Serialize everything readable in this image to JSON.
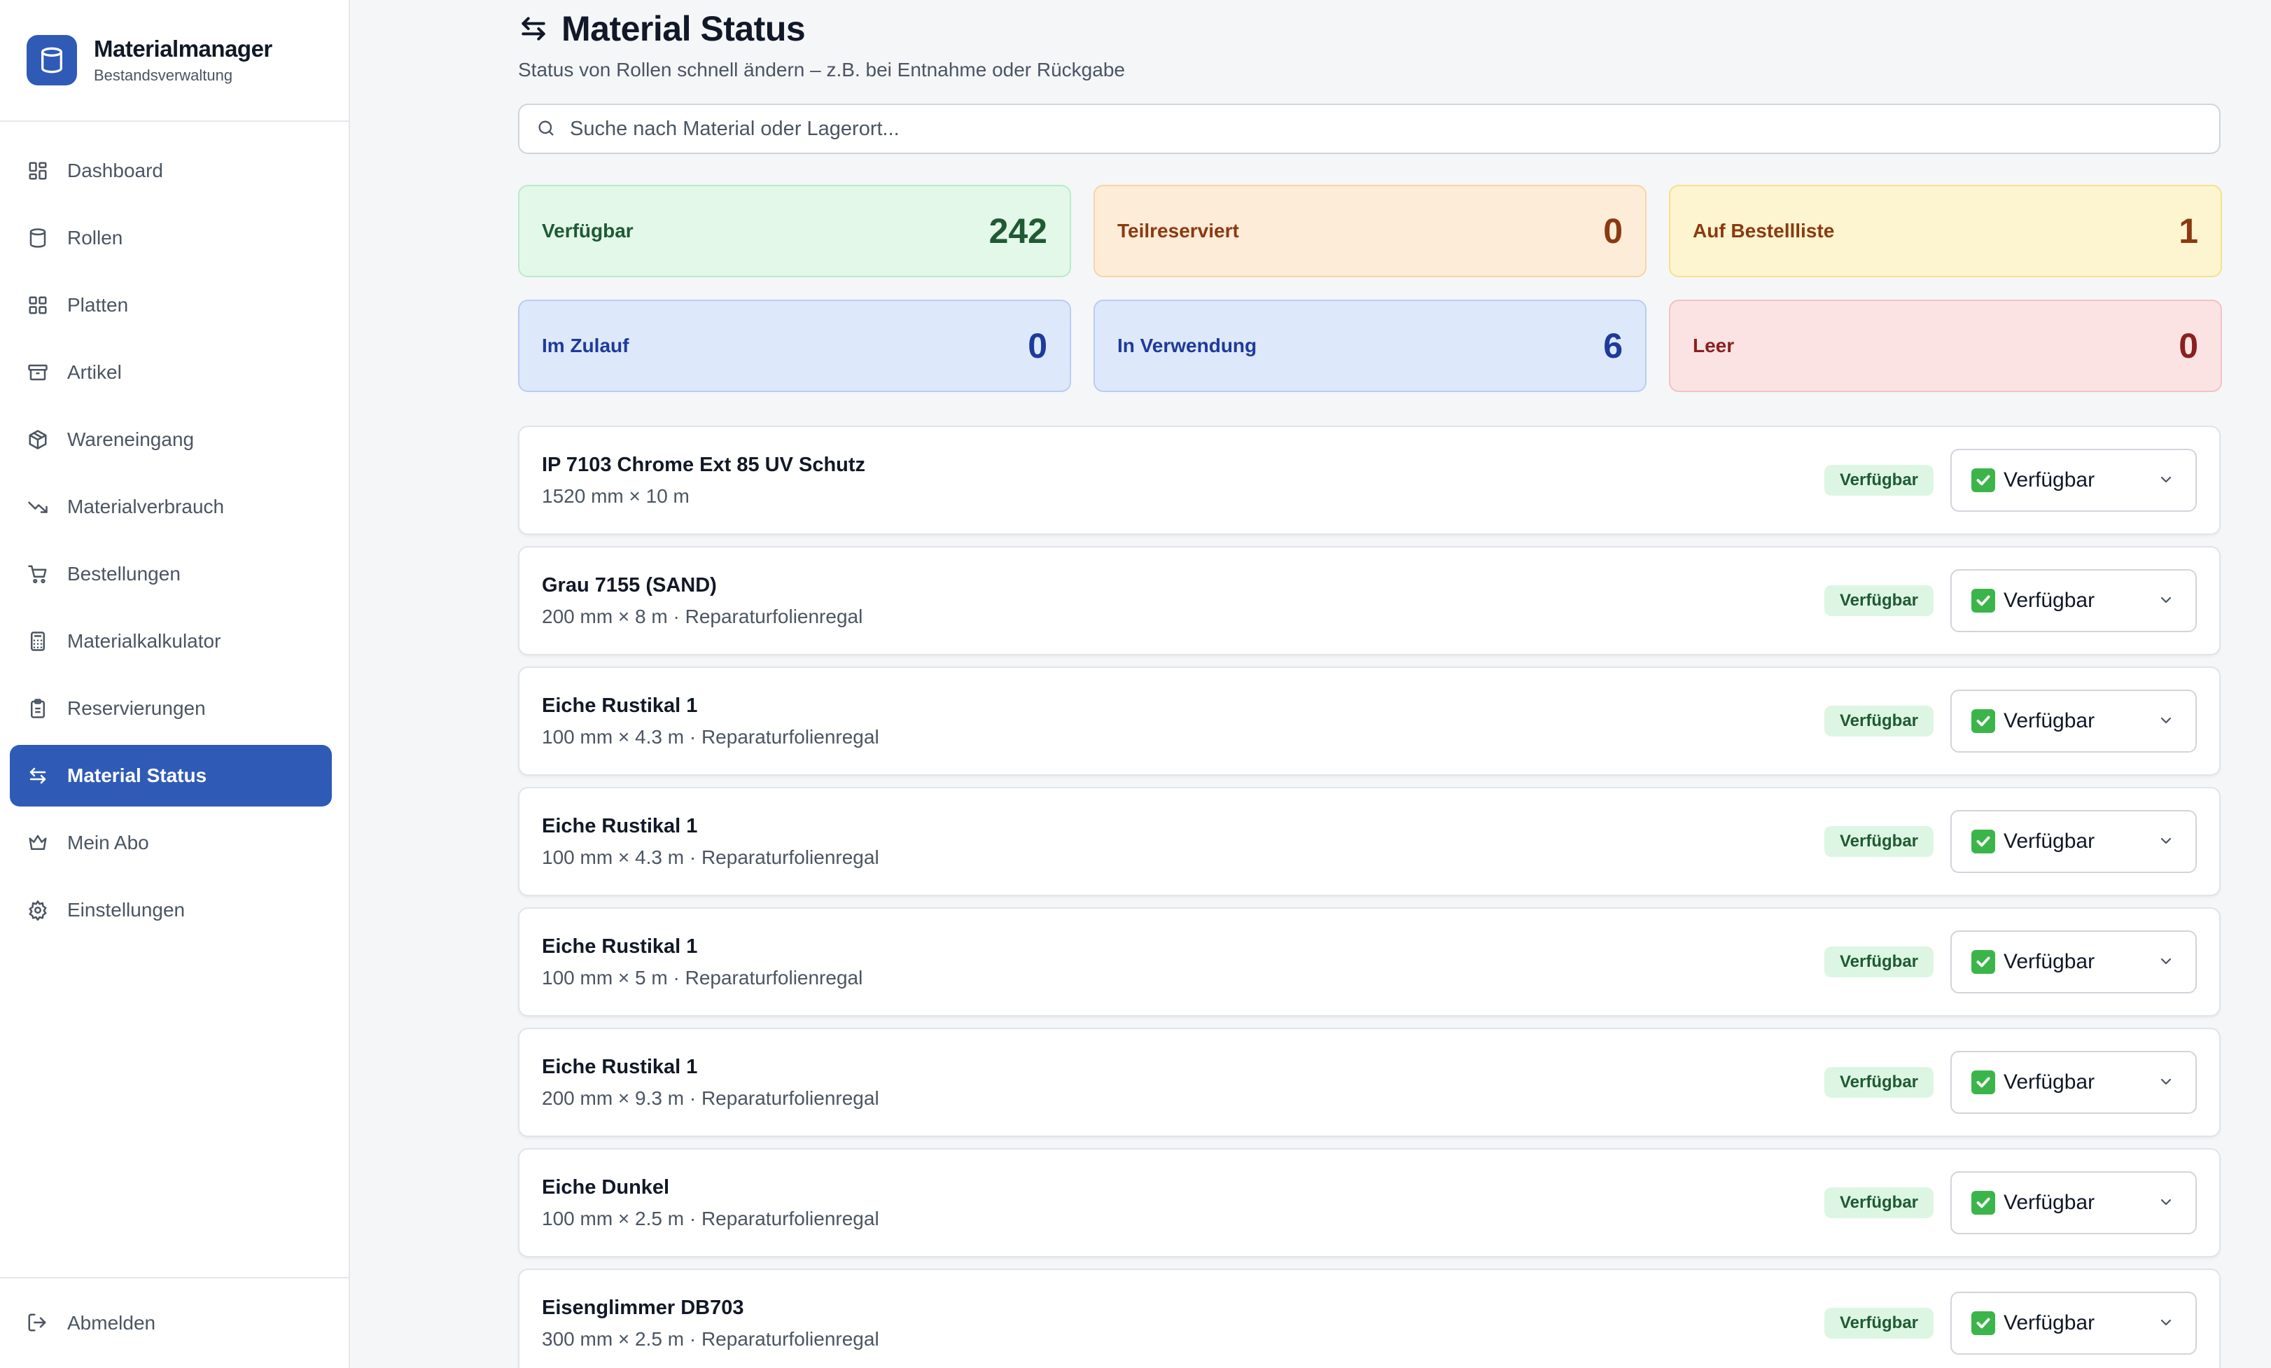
{
  "brand": {
    "name": "Materialmanager",
    "subtitle": "Bestandsverwaltung",
    "icon": "database-icon"
  },
  "sidebar": {
    "items": [
      {
        "label": "Dashboard",
        "icon": "dashboard-icon",
        "active": false
      },
      {
        "label": "Rollen",
        "icon": "roll-icon",
        "active": false
      },
      {
        "label": "Platten",
        "icon": "grid-icon",
        "active": false
      },
      {
        "label": "Artikel",
        "icon": "archive-icon",
        "active": false
      },
      {
        "label": "Wareneingang",
        "icon": "package-icon",
        "active": false
      },
      {
        "label": "Materialverbrauch",
        "icon": "trending-down-icon",
        "active": false
      },
      {
        "label": "Bestellungen",
        "icon": "cart-icon",
        "active": false
      },
      {
        "label": "Materialkalkulator",
        "icon": "calculator-icon",
        "active": false
      },
      {
        "label": "Reservierungen",
        "icon": "clipboard-icon",
        "active": false
      },
      {
        "label": "Material Status",
        "icon": "arrows-swap-icon",
        "active": true
      },
      {
        "label": "Mein Abo",
        "icon": "crown-icon",
        "active": false
      },
      {
        "label": "Einstellungen",
        "icon": "gear-icon",
        "active": false
      }
    ],
    "logout_label": "Abmelden"
  },
  "page": {
    "title": "Material Status",
    "subtitle": "Status von Rollen schnell ändern – z.B. bei Entnahme oder Rückgabe"
  },
  "search": {
    "placeholder": "Suche nach Material oder Lagerort...",
    "value": ""
  },
  "stats": [
    {
      "label": "Verfügbar",
      "count": "242",
      "color": "#e3f8e9"
    },
    {
      "label": "Teilreserviert",
      "count": "0",
      "color": "#fdecd8"
    },
    {
      "label": "Auf Bestellliste",
      "count": "1",
      "color": "#fdf5cf"
    },
    {
      "label": "Im Zulauf",
      "count": "0",
      "color": "#dde8fb"
    },
    {
      "label": "In Verwendung",
      "count": "6",
      "color": "#dde8fb"
    },
    {
      "label": "Leer",
      "count": "0",
      "color": "#fbe3e3"
    }
  ],
  "rolls": [
    {
      "title": "IP 7103 Chrome Ext 85 UV Schutz",
      "meta": "1520 mm × 10 m",
      "badge": "Verfügbar",
      "status": "Verfügbar"
    },
    {
      "title": "Grau 7155 (SAND)",
      "meta": "200 mm × 8 m · Reparaturfolienregal",
      "badge": "Verfügbar",
      "status": "Verfügbar"
    },
    {
      "title": "Eiche Rustikal 1",
      "meta": "100 mm × 4.3 m · Reparaturfolienregal",
      "badge": "Verfügbar",
      "status": "Verfügbar"
    },
    {
      "title": "Eiche Rustikal 1",
      "meta": "100 mm × 4.3 m · Reparaturfolienregal",
      "badge": "Verfügbar",
      "status": "Verfügbar"
    },
    {
      "title": "Eiche Rustikal 1",
      "meta": "100 mm × 5 m · Reparaturfolienregal",
      "badge": "Verfügbar",
      "status": "Verfügbar"
    },
    {
      "title": "Eiche Rustikal 1",
      "meta": "200 mm × 9.3 m · Reparaturfolienregal",
      "badge": "Verfügbar",
      "status": "Verfügbar"
    },
    {
      "title": "Eiche Dunkel",
      "meta": "100 mm × 2.5 m · Reparaturfolienregal",
      "badge": "Verfügbar",
      "status": "Verfügbar"
    },
    {
      "title": "Eisenglimmer DB703",
      "meta": "300 mm × 2.5 m · Reparaturfolienregal",
      "badge": "Verfügbar",
      "status": "Verfügbar"
    }
  ]
}
